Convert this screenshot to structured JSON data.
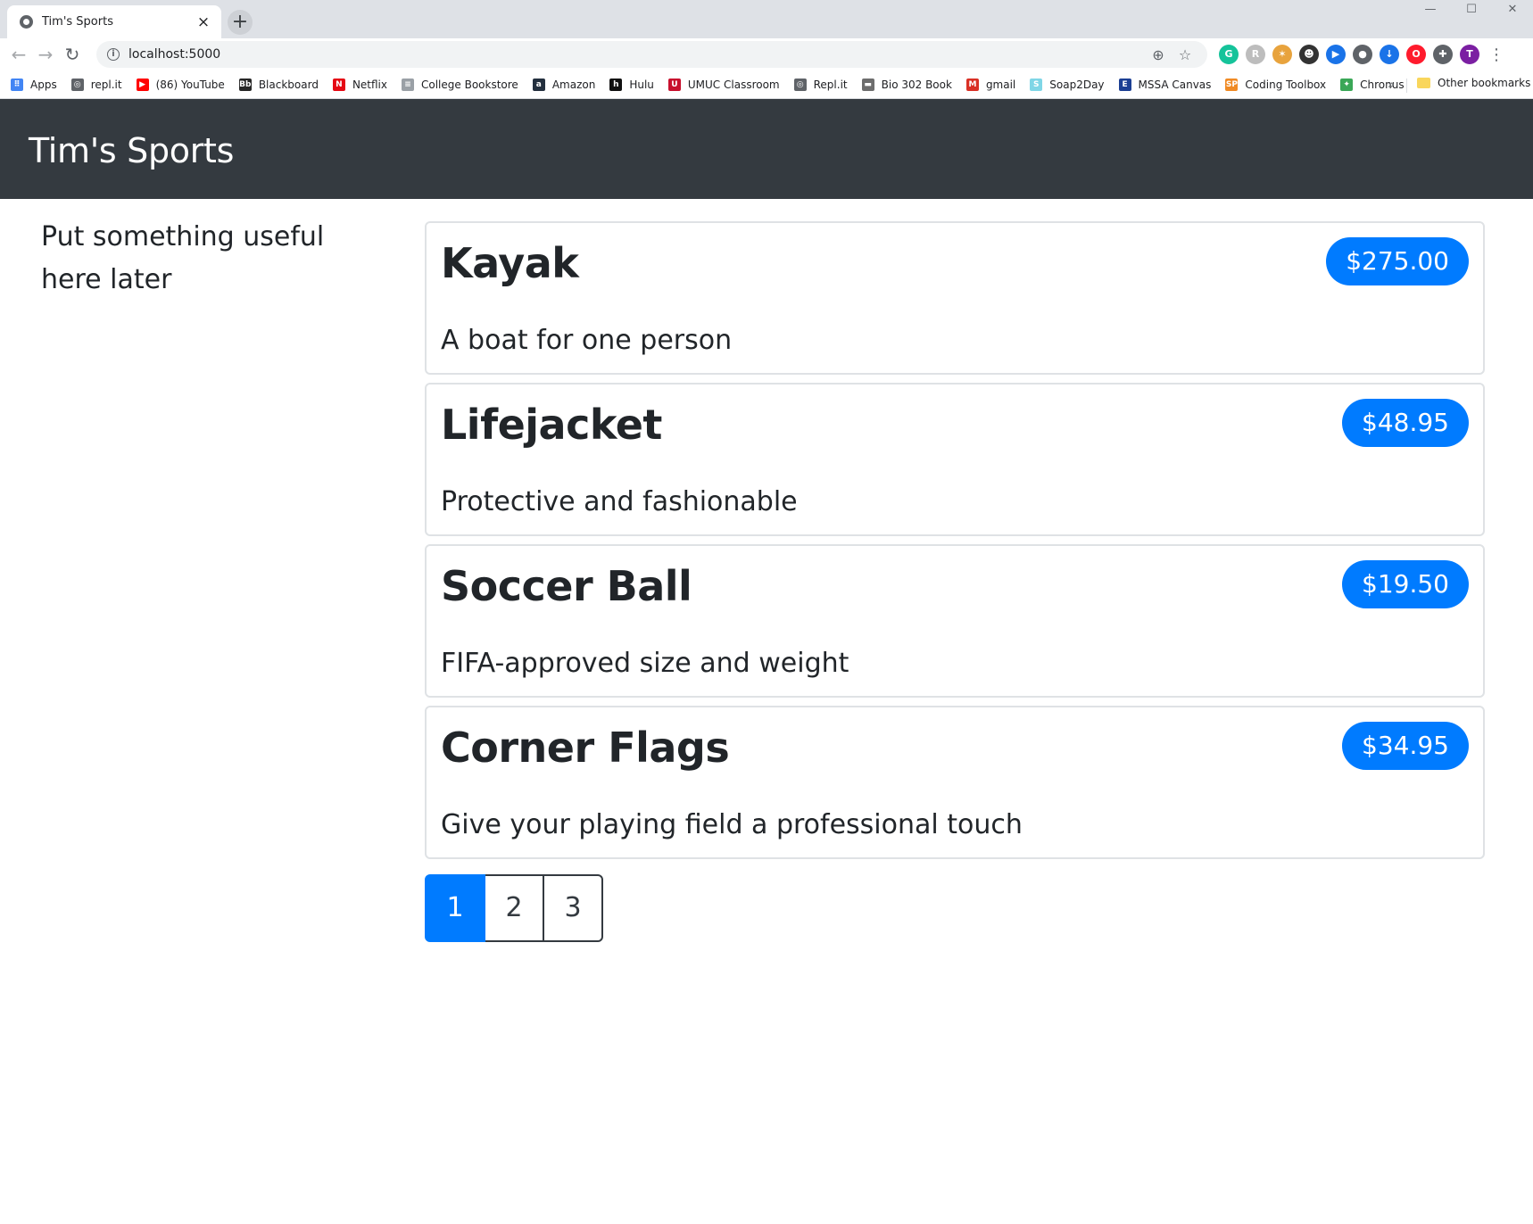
{
  "browser": {
    "tab_title": "Tim's Sports",
    "tab_close": "×",
    "new_tab": "+",
    "window_controls": [
      "—",
      "☐",
      "✕"
    ],
    "url": "localhost:5000",
    "bookmarks": [
      {
        "label": "Apps",
        "icon": "apps-grid-icon",
        "color": "#4285f4",
        "glyph": "⠿"
      },
      {
        "label": "repl.it",
        "icon": "replit-icon",
        "color": "#5f6368",
        "glyph": "◎"
      },
      {
        "label": "(86) YouTube",
        "icon": "youtube-icon",
        "color": "#ff0000",
        "glyph": "▶"
      },
      {
        "label": "Blackboard",
        "icon": "blackboard-icon",
        "color": "#262626",
        "glyph": "Bb"
      },
      {
        "label": "Netflix",
        "icon": "netflix-icon",
        "color": "#e50914",
        "glyph": "N"
      },
      {
        "label": "College Bookstore",
        "icon": "page-icon",
        "color": "#9aa0a6",
        "glyph": "≡"
      },
      {
        "label": "Amazon",
        "icon": "amazon-icon",
        "color": "#232f3e",
        "glyph": "a"
      },
      {
        "label": "Hulu",
        "icon": "hulu-icon",
        "color": "#111111",
        "glyph": "h"
      },
      {
        "label": "UMUC Classroom",
        "icon": "umuc-icon",
        "color": "#c8102e",
        "glyph": "U"
      },
      {
        "label": "Repl.it",
        "icon": "replit-icon",
        "color": "#5f6368",
        "glyph": "◎"
      },
      {
        "label": "Bio 302 Book",
        "icon": "book-icon",
        "color": "#6d6d6d",
        "glyph": "▬"
      },
      {
        "label": "gmail",
        "icon": "gmail-icon",
        "color": "#d93025",
        "glyph": "M"
      },
      {
        "label": "Soap2Day",
        "icon": "soap2day-icon",
        "color": "#7fd6e6",
        "glyph": "S"
      },
      {
        "label": "MSSA Canvas",
        "icon": "canvas-icon",
        "color": "#1c3f94",
        "glyph": "E"
      },
      {
        "label": "Coding Toolbox",
        "icon": "toolbox-icon",
        "color": "#f08a24",
        "glyph": "SP"
      },
      {
        "label": "Chronus",
        "icon": "chronus-icon",
        "color": "#3aa757",
        "glyph": "✦"
      }
    ],
    "more_bookmarks": "»",
    "other_bookmarks": "Other bookmarks",
    "extensions": [
      {
        "name": "grammarly-extension-icon",
        "color": "#15c39a",
        "glyph": "G"
      },
      {
        "name": "extension-icon",
        "color": "#bdbdbd",
        "glyph": "R"
      },
      {
        "name": "extension-icon",
        "color": "#e8a33d",
        "glyph": "✶"
      },
      {
        "name": "extension-icon",
        "color": "#333333",
        "glyph": "☻"
      },
      {
        "name": "play-extension-icon",
        "color": "#1a73e8",
        "glyph": "▶"
      },
      {
        "name": "extension-icon",
        "color": "#5f6368",
        "glyph": "●"
      },
      {
        "name": "download-extension-icon",
        "color": "#1a73e8",
        "glyph": "↓"
      },
      {
        "name": "opera-extension-icon",
        "color": "#ff1b2d",
        "glyph": "O"
      },
      {
        "name": "puzzle-extensions-icon",
        "color": "#5f6368",
        "glyph": "✚"
      },
      {
        "name": "profile-avatar",
        "color": "#7b1fa2",
        "glyph": "T"
      }
    ]
  },
  "navbar": {
    "brand": "Tim's Sports"
  },
  "sidebar": {
    "text": "Put something useful here later"
  },
  "products": [
    {
      "name": "Kayak",
      "price": "$275.00",
      "description": "A boat for one person"
    },
    {
      "name": "Lifejacket",
      "price": "$48.95",
      "description": "Protective and fashionable"
    },
    {
      "name": "Soccer Ball",
      "price": "$19.50",
      "description": "FIFA-approved size and weight"
    },
    {
      "name": "Corner Flags",
      "price": "$34.95",
      "description": "Give your playing field a professional touch"
    }
  ],
  "pagination": {
    "pages": [
      "1",
      "2",
      "3"
    ],
    "current": "1"
  },
  "colors": {
    "navbar_bg": "#343a40",
    "primary": "#007bff"
  }
}
